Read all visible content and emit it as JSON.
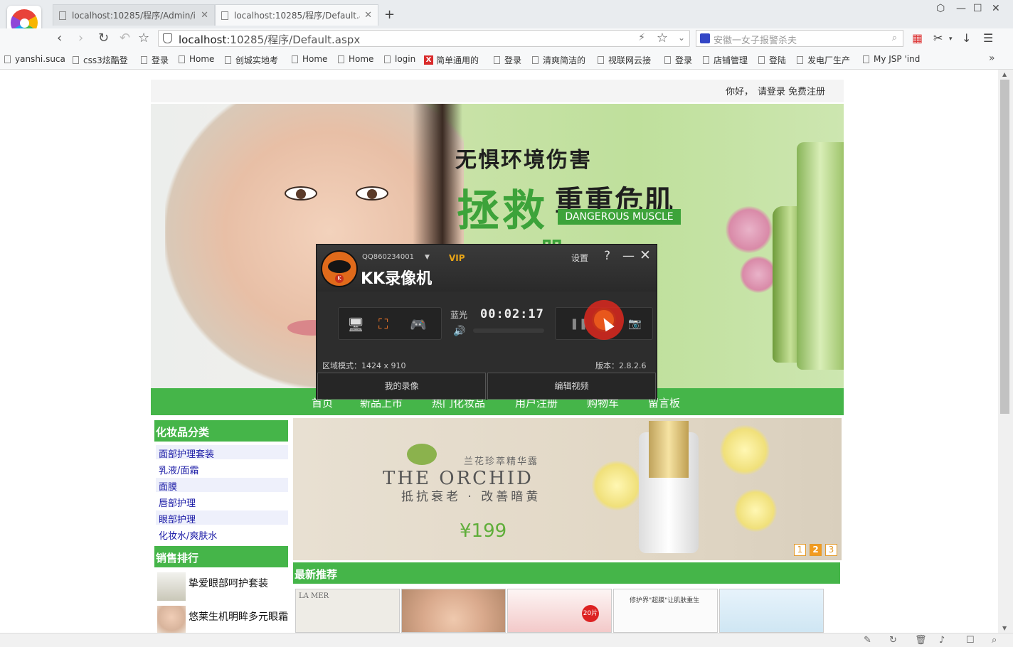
{
  "browser": {
    "tabs": [
      {
        "title": "localhost:10285/程序/Admin/i",
        "active": false
      },
      {
        "title": "localhost:10285/程序/Default.a",
        "active": true
      }
    ],
    "new_tab": "+",
    "url_host": "localhost",
    "url_rest": ":10285/程序/Default.aspx",
    "search_placeholder": "安徽一女子报警杀夫",
    "bookmarks": [
      "yanshi.suca",
      "css3炫酷登",
      "登录",
      "Home",
      "创城实地考",
      "Home",
      "Home",
      "login",
      "简单通用的",
      "登录",
      "清爽简洁的",
      "视联网云接",
      "登录",
      "店铺管理",
      "登陆",
      "发电厂生产",
      "My JSP 'ind"
    ],
    "bookmarks_more": "»"
  },
  "page": {
    "greeting": "你好，",
    "login_link": "请登录",
    "register_link": "免费注册",
    "hero": {
      "line1": "无惧环境伤害",
      "line2_big": "拯救",
      "line2_rest": "重重危肌",
      "tag": "DANGEROUS MUSCLE",
      "line3": "肌"
    },
    "nav": [
      "首页",
      "新品上市",
      "热门化妆品",
      "用户注册",
      "购物车",
      "留言板"
    ],
    "sidebar": {
      "cat_title": "化妆品分类",
      "categories": [
        "面部护理套装",
        "乳液/面霜",
        "面膜",
        "唇部护理",
        "眼部护理",
        "化妆水/爽肤水"
      ],
      "rank_title": "销售排行",
      "rank_items": [
        "挚爱眼部呵护套装",
        "悠莱生机明眸多元眼霜"
      ]
    },
    "banner": {
      "subtitle": "兰花珍萃精华露",
      "title": "THE ORCHID",
      "slogan": "抵抗衰老 · 改善暗黄",
      "price": "¥199",
      "pages": [
        "1",
        "2",
        "3"
      ],
      "current_page": "2"
    },
    "new_title": "最新推荐",
    "product_labels": [
      "LA MER",
      "",
      "20片",
      "修护界\"超膜\"让肌肤重生",
      ""
    ]
  },
  "recorder": {
    "qq": "QQ860234001",
    "vip": "VIP",
    "title": "KK录像机",
    "settings": "设置",
    "help": "?",
    "minimize": "—",
    "close": "✕",
    "quality": "蓝光",
    "time": "00:02:17",
    "region": "区域模式：1424 x 910",
    "version": "版本：2.8.2.6",
    "my_videos": "我的录像",
    "edit_video": "编辑视频"
  }
}
